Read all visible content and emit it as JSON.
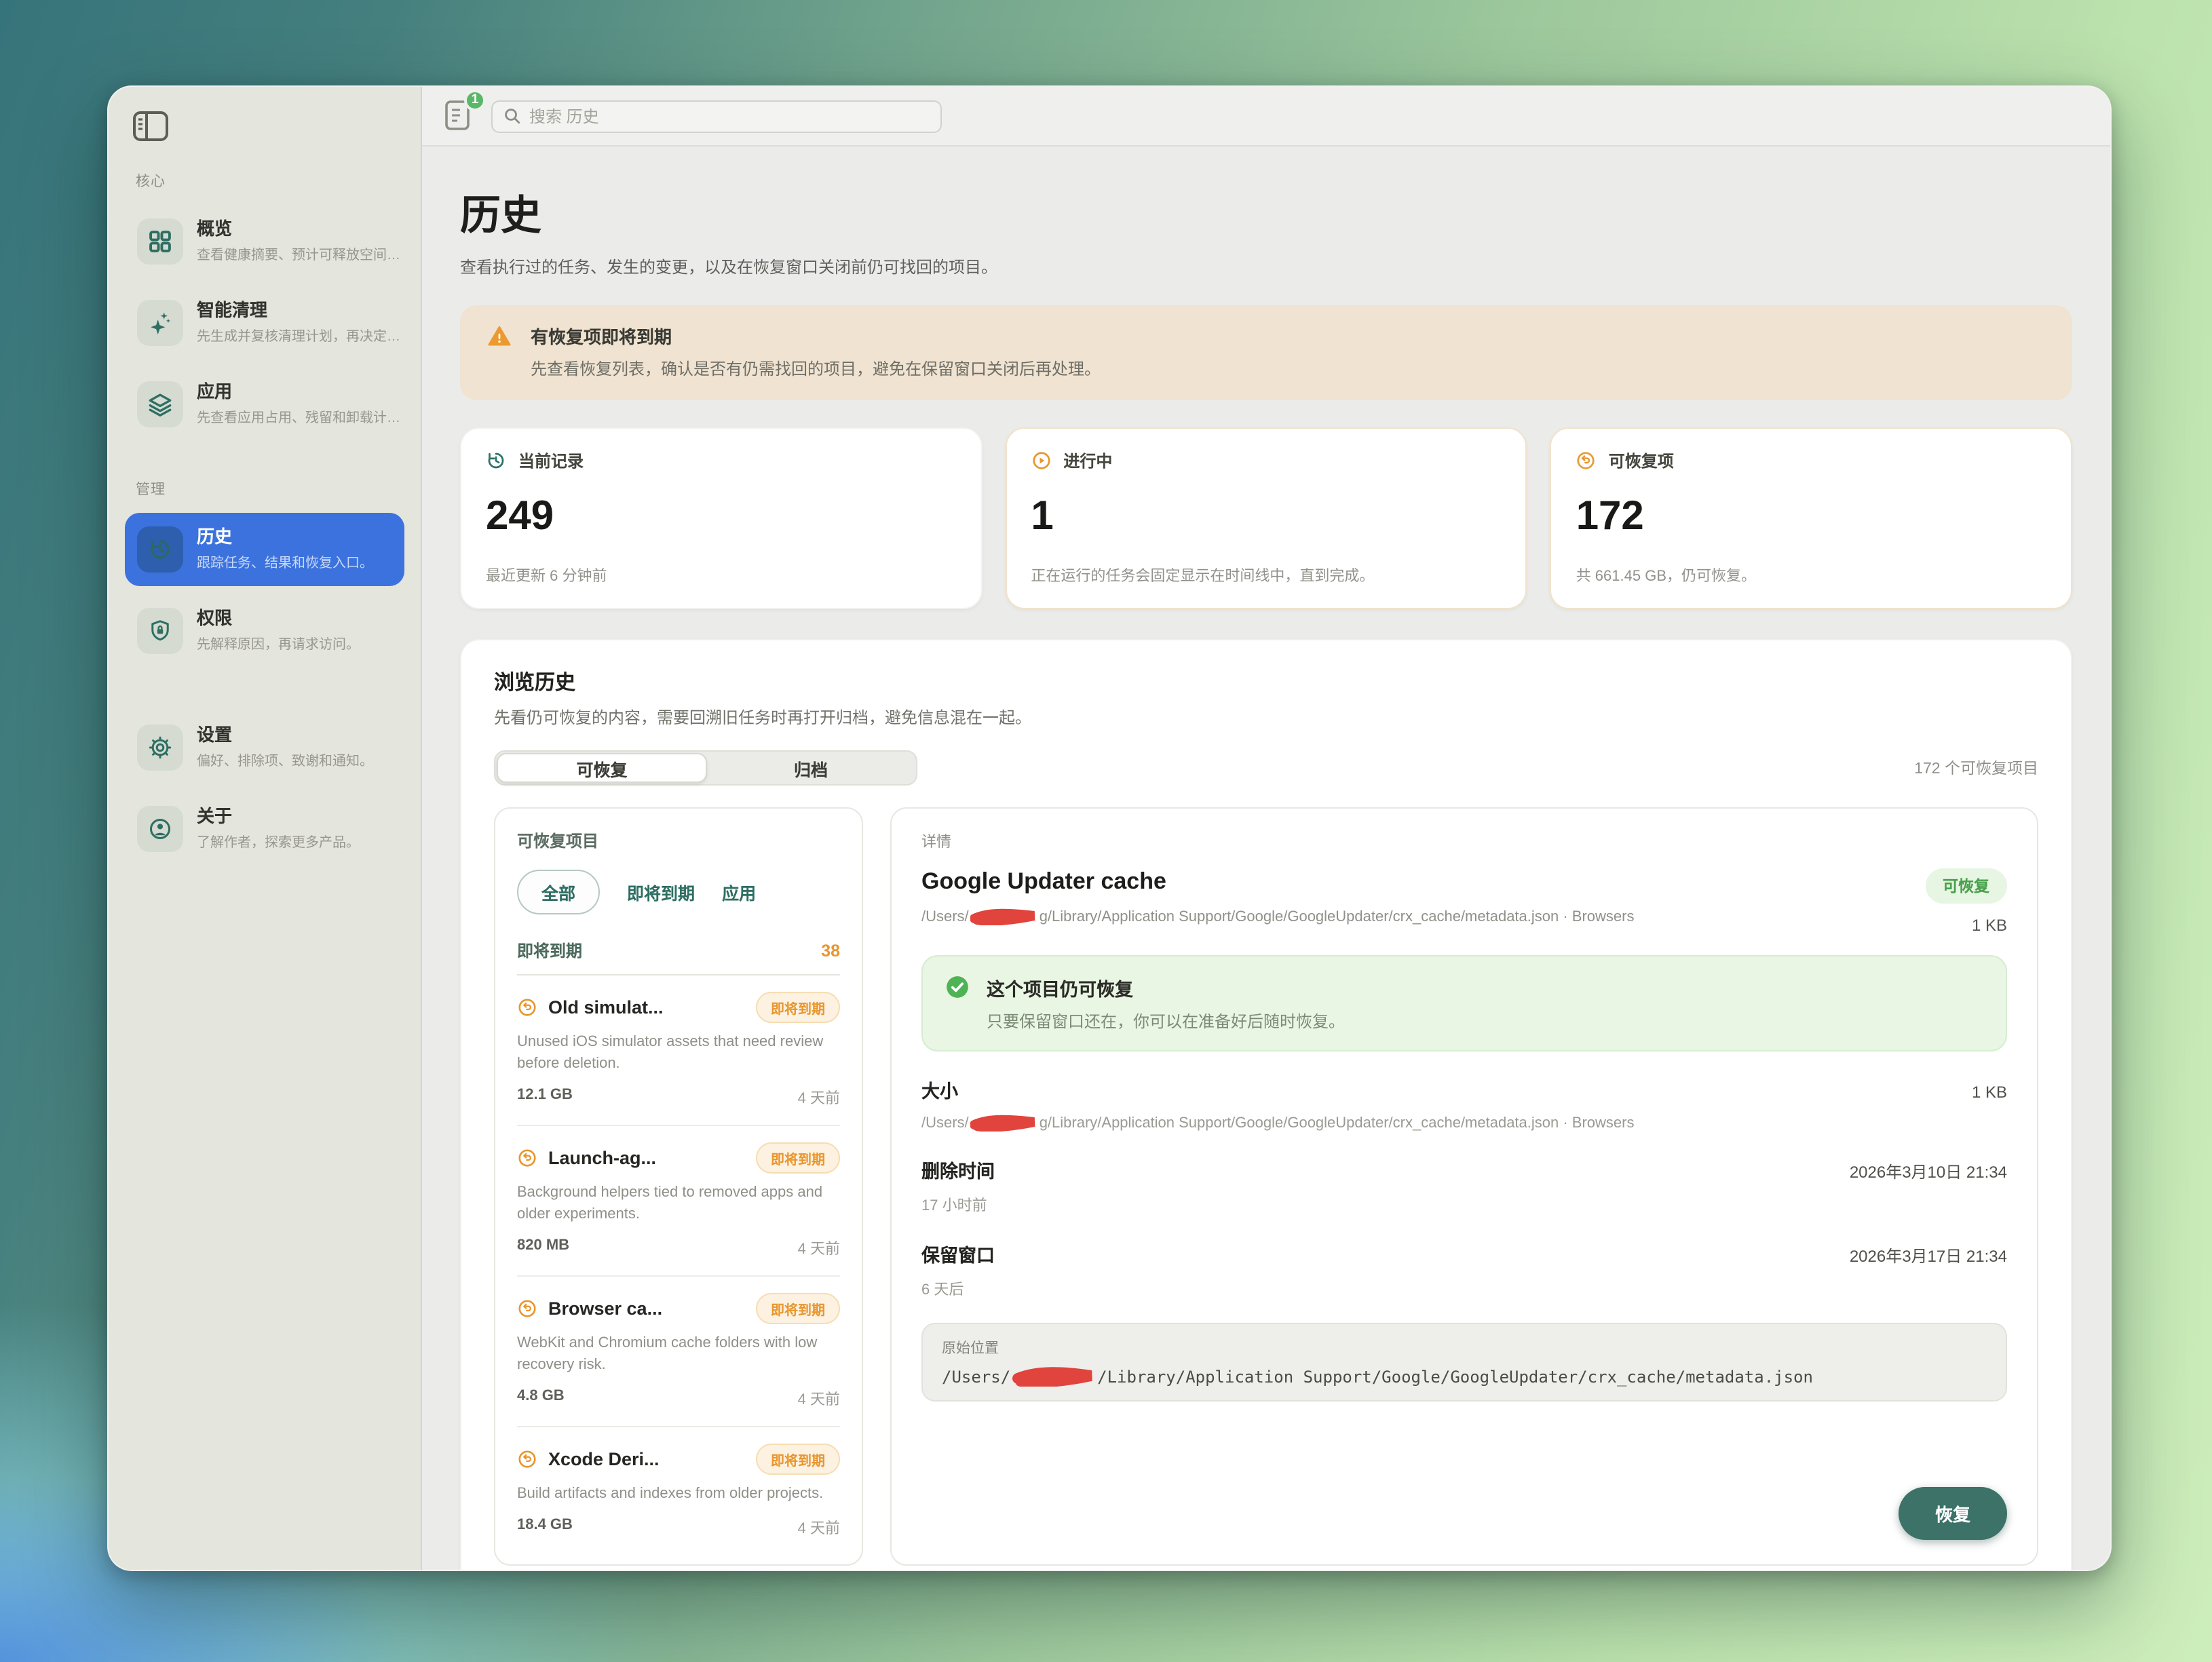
{
  "colors": {
    "accent": "#2e6e63",
    "selected": "#3b72de",
    "orange": "#e8962e",
    "green": "#4db354",
    "red": "#e0443c"
  },
  "sidebar": {
    "core_label": "核心",
    "manage_label": "管理",
    "items": [
      {
        "label": "概览",
        "desc": "查看健康摘要、预计可释放空间…"
      },
      {
        "label": "智能清理",
        "desc": "先生成并复核清理计划，再决定…"
      },
      {
        "label": "应用",
        "desc": "先查看应用占用、残留和卸载计…"
      },
      {
        "label": "历史",
        "desc": "跟踪任务、结果和恢复入口。"
      },
      {
        "label": "权限",
        "desc": "先解释原因，再请求访问。"
      },
      {
        "label": "设置",
        "desc": "偏好、排除项、致谢和通知。"
      },
      {
        "label": "关于",
        "desc": "了解作者，探索更多产品。"
      }
    ]
  },
  "toolbar": {
    "badge_count": "1",
    "search_placeholder": "搜索 历史"
  },
  "page": {
    "title": "历史",
    "subtitle": "查看执行过的任务、发生的变更，以及在恢复窗口关闭前仍可找回的项目。",
    "banner": {
      "title": "有恢复项即将到期",
      "body": "先查看恢复列表，确认是否有仍需找回的项目，避免在保留窗口关闭后再处理。"
    }
  },
  "stats": [
    {
      "label": "当前记录",
      "value": "249",
      "footer": "最近更新 6 分钟前"
    },
    {
      "label": "进行中",
      "value": "1",
      "footer": "正在运行的任务会固定显示在时间线中，直到完成。"
    },
    {
      "label": "可恢复项",
      "value": "172",
      "footer": "共 661.45 GB，仍可恢复。"
    }
  ],
  "browse": {
    "title": "浏览历史",
    "subtitle": "先看仍可恢复的内容，需要回溯旧任务时再打开归档，避免信息混在一起。",
    "tab_recoverable": "可恢复",
    "tab_archive": "归档",
    "count_note": "172 个可恢复项目"
  },
  "list": {
    "title": "可恢复项目",
    "filters": [
      "全部",
      "即将到期",
      "应用"
    ],
    "group_label": "即将到期",
    "group_count": "38",
    "items": [
      {
        "title": "Old simulat...",
        "badge": "即将到期",
        "desc": "Unused iOS simulator assets that need review before deletion.",
        "size": "12.1 GB",
        "time": "4 天前"
      },
      {
        "title": "Launch-ag...",
        "badge": "即将到期",
        "desc": "Background helpers tied to removed apps and older experiments.",
        "size": "820 MB",
        "time": "4 天前"
      },
      {
        "title": "Browser ca...",
        "badge": "即将到期",
        "desc": "WebKit and Chromium cache folders with low recovery risk.",
        "size": "4.8 GB",
        "time": "4 天前"
      },
      {
        "title": "Xcode Deri...",
        "badge": "即将到期",
        "desc": "Build artifacts and indexes from older projects.",
        "size": "18.4 GB",
        "time": "4 天前"
      }
    ]
  },
  "detail": {
    "label": "详情",
    "title": "Google Updater cache",
    "status_badge": "可恢复",
    "header_size": "1 KB",
    "path_prefix": "/Users/",
    "path_suffix": "g/Library/Application Support/Google/GoogleUpdater/crx_cache/metadata.json · Browsers",
    "note_title": "这个项目仍可恢复",
    "note_body": "只要保留窗口还在，你可以在准备好后随时恢复。",
    "size_label": "大小",
    "size_value": "1 KB",
    "deleted_label": "删除时间",
    "deleted_date": "2026年3月10日 21:34",
    "deleted_rel": "17 小时前",
    "window_label": "保留窗口",
    "window_date": "2026年3月17日 21:34",
    "window_rel": "6 天后",
    "origin_label": "原始位置",
    "origin_prefix": "/Users/",
    "origin_suffix": "/Library/Application Support/Google/GoogleUpdater/crx_cache/metadata.json",
    "restore_button": "恢复"
  }
}
